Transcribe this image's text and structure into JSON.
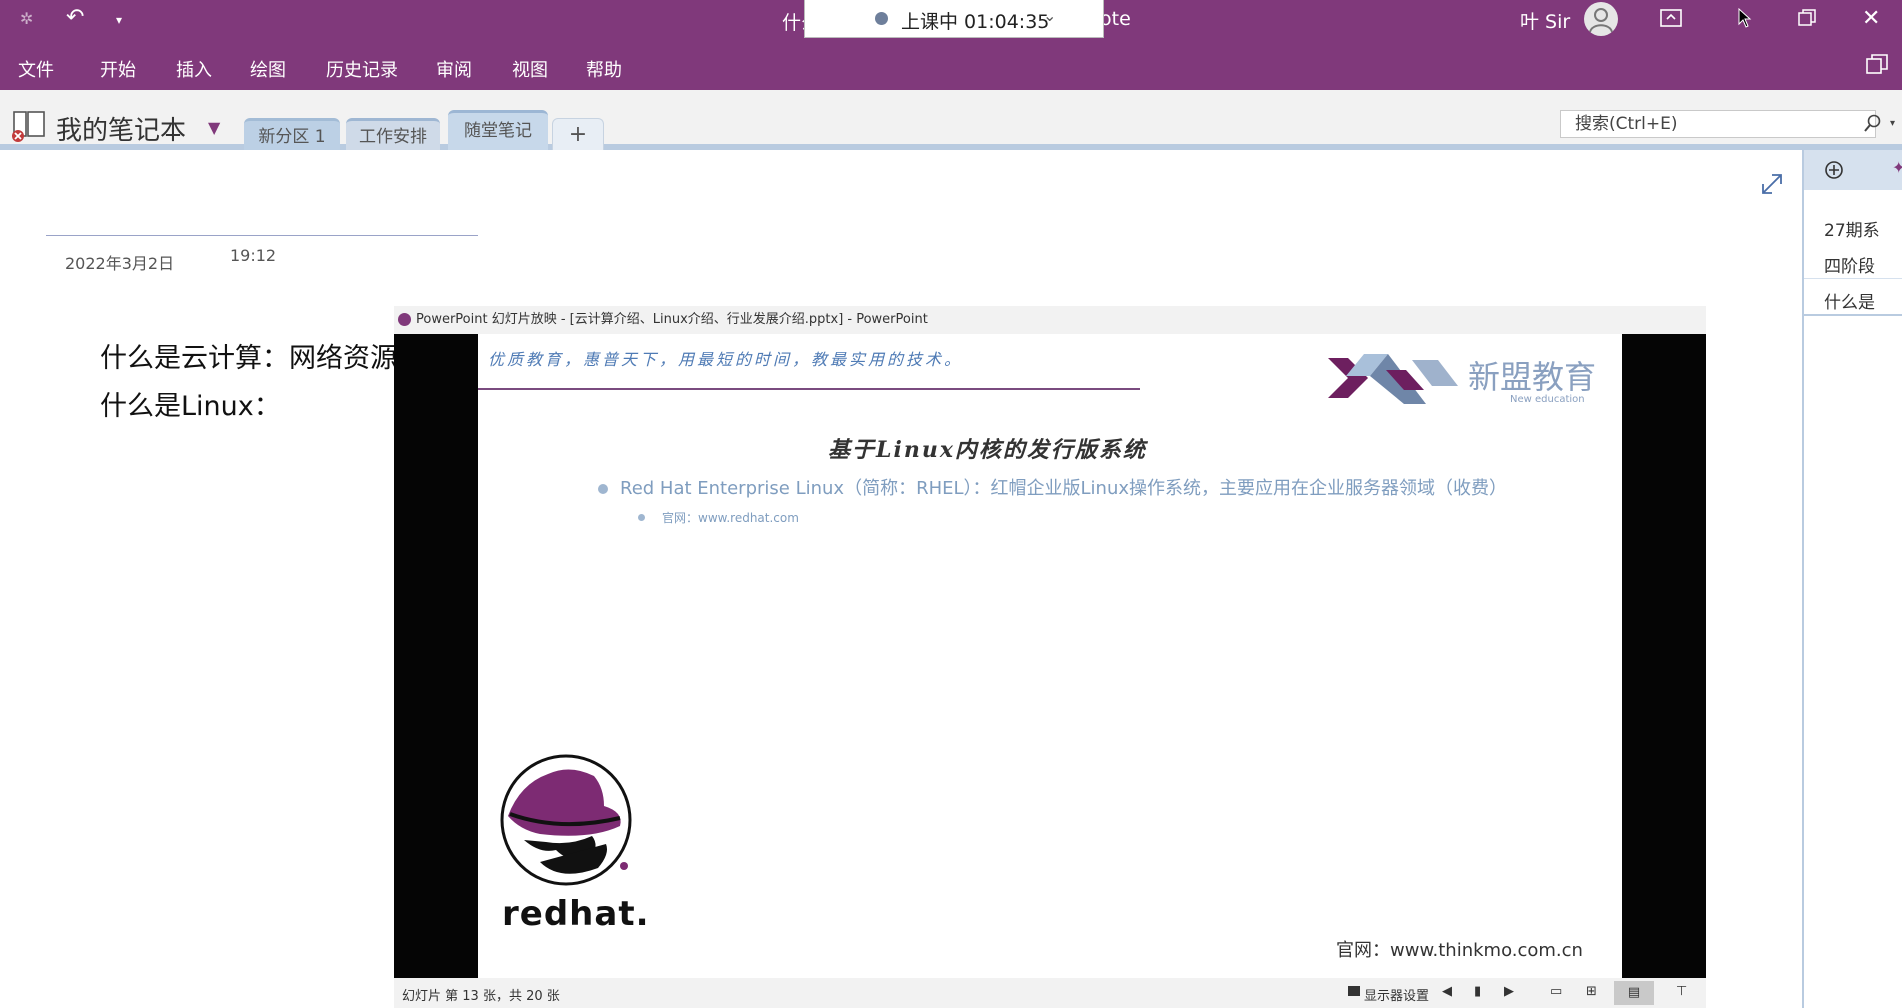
{
  "titlebar": {
    "title_left": "什么",
    "title_right": "ote",
    "lesson_status": "上课中 01:04:35",
    "user_name": "叶 Sir"
  },
  "menu": [
    "文件",
    "开始",
    "插入",
    "绘图",
    "历史记录",
    "审阅",
    "视图",
    "帮助"
  ],
  "notebook": {
    "name": "我的笔记本",
    "tabs": [
      "新分区 1",
      "工作安排",
      "随堂笔记"
    ],
    "add_tab": "+",
    "search_placeholder": "搜索(Ctrl+E)"
  },
  "pages_pane": {
    "items": [
      "27期系",
      "四阶段",
      "什么是"
    ]
  },
  "note": {
    "date": "2022年3月2日",
    "time": "19:12",
    "lines": [
      "什么是云计算：网络资源",
      "什么是Linux："
    ]
  },
  "ppt": {
    "window_title": "PowerPoint 幻灯片放映 - [云计算介绍、Linux介绍、行业发展介绍.pptx] - PowerPoint",
    "slide_motto": "优质教育，惠普天下，用最短的时间，教最实用的技术。",
    "brand_name": "新盟教育",
    "brand_sub": "New education",
    "slide_title": "基于Linux内核的发行版系统",
    "bullet1": "Red Hat Enterprise Linux（简称：RHEL）：红帽企业版Linux操作系统，主要应用在企业服务器领域（收费）",
    "bullet2": "官网：www.redhat.com",
    "redhat_logo_text": "redhat.",
    "footer_site": "官网：www.thinkmo.com.cn",
    "status_slide": "幻灯片 第 13 张，共 20 张",
    "status_display": "显示器设置"
  },
  "colors": {
    "onenote_purple": "#80397b",
    "tab_active": "#c9d7e8",
    "brand_purple": "#6d1f5f"
  }
}
